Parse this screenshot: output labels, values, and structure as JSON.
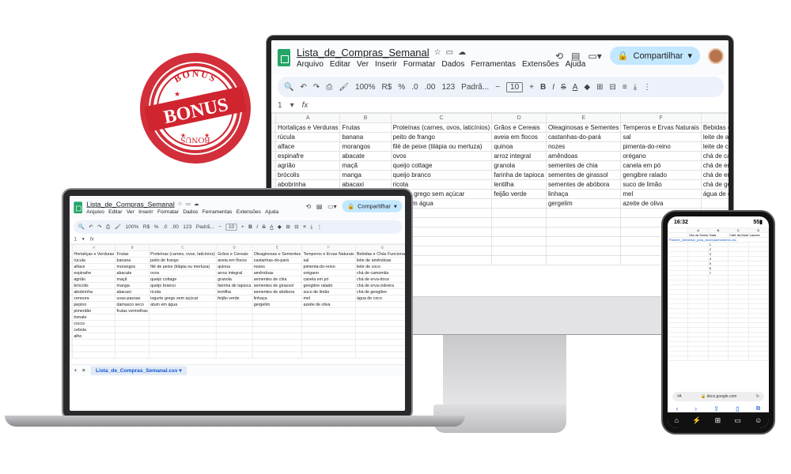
{
  "stamp": {
    "top_text": "BONUS",
    "center_text": "BONUS",
    "bottom_text": "BONUS",
    "color": "#d0242f"
  },
  "sheet": {
    "title": "Lista_de_Compras_Semanal",
    "menu": [
      "Arquivo",
      "Editar",
      "Ver",
      "Inserir",
      "Formatar",
      "Dados",
      "Ferramentas",
      "Extensões",
      "Ajuda"
    ],
    "share_label": "Compartilhar",
    "toolbar": {
      "zoom": "100%",
      "currency": "R$",
      "percent": "%",
      "number_format": "123",
      "font": "Padrã...",
      "font_size": "10",
      "bold": "B",
      "italic": "I",
      "strike": "S",
      "text_color": "A"
    },
    "cell_ref": "1",
    "fx": "fx",
    "columns": [
      "A",
      "B",
      "C",
      "D",
      "E",
      "F",
      "G",
      "H"
    ],
    "headers": [
      "Hortaliças e Verduras",
      "Frutas",
      "Proteínas (carnes, ovos, laticínios)",
      "Grãos e Cereais",
      "Oleaginosas e Sementes",
      "Temperos e Ervas Naturais",
      "Bebidas e Chás Funcionais"
    ],
    "rows": [
      [
        "rúcula",
        "banana",
        "peito de frango",
        "aveia em flocos",
        "castanhas-do-pará",
        "sal",
        "leite de amêndoas"
      ],
      [
        "alface",
        "morangos",
        "filé de peixe (tilápia ou merluza)",
        "quinoa",
        "nozes",
        "pimenta-do-reino",
        "leite de coco"
      ],
      [
        "espinafre",
        "abacate",
        "ovos",
        "arroz integral",
        "amêndoas",
        "orégano",
        "chá de camomila"
      ],
      [
        "agrião",
        "maçã",
        "queijo cottage",
        "granola",
        "sementes de chia",
        "canela em pó",
        "chá de erva-doce"
      ],
      [
        "brócolis",
        "manga",
        "queijo branco",
        "farinha de tapioca",
        "sementes de girassol",
        "gengibre ralado",
        "chá de erva-cidreira"
      ],
      [
        "abobrinha",
        "abacaxi",
        "ricota",
        "lentilha",
        "sementes de abóbora",
        "suco de limão",
        "chá de gengibre"
      ],
      [
        "cenoura",
        "uvas-passas",
        "iogurte grego sem açúcar",
        "feijão verde",
        "linhaça",
        "mel",
        "água de coco"
      ],
      [
        "pepino",
        "damasco seco",
        "atum em água",
        "",
        "gergelim",
        "azeite de oliva",
        ""
      ],
      [
        "pimentão",
        "frutas vermelhas",
        "",
        "",
        "",
        "",
        ""
      ]
    ],
    "laptop_extra": [
      "tomate",
      "cocco",
      "cebola",
      "alho"
    ],
    "tab_name": "Lista_de_Compras_Semanal.csv"
  },
  "phone": {
    "time": "16:32",
    "battery": "55",
    "columns": [
      "A",
      "B",
      "C",
      "D"
    ],
    "header_row": [
      "Dia da Semana",
      "Data",
      "Café da Manhã",
      "Lanche"
    ],
    "link_text": "Planner_Alimentar_para_Acompanhamento.csv",
    "url": "docs.google.com",
    "row_numbers": [
      "1",
      "2",
      "3",
      "4",
      "5",
      "6",
      "7"
    ]
  }
}
